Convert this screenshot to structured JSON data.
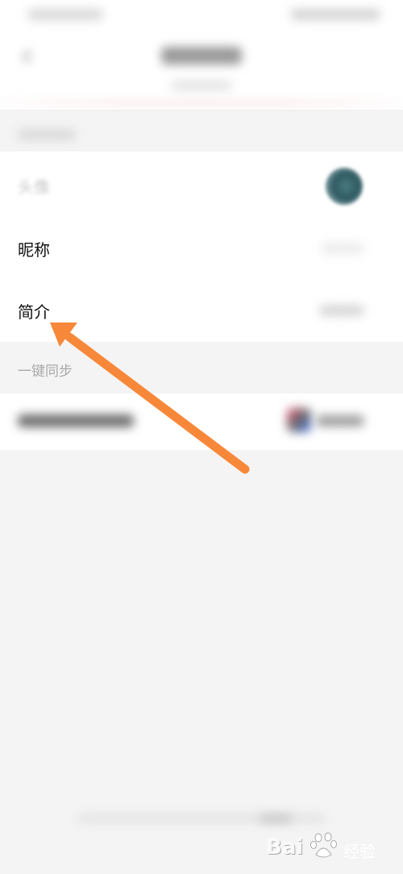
{
  "list": {
    "rows": [
      {
        "label": "头像"
      },
      {
        "label": "昵称"
      },
      {
        "label": "简介"
      }
    ]
  },
  "sync": {
    "header": "一键同步"
  },
  "watermark": {
    "brand": "Bai",
    "brand_suffix": "经验",
    "icon": "baidu-paw-icon"
  },
  "annotation": {
    "color": "#f7883a",
    "target": "简介"
  }
}
